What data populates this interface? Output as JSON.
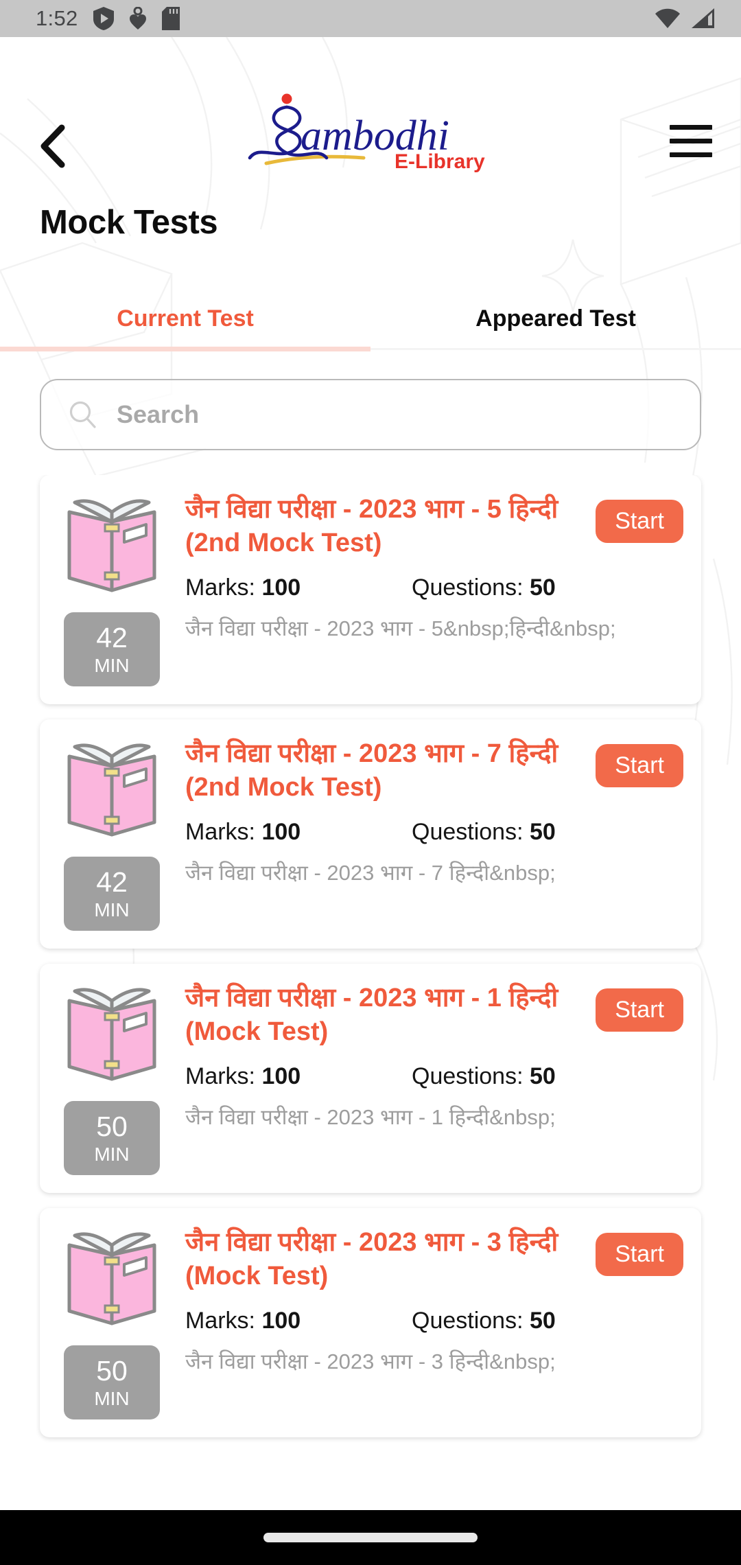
{
  "status_bar": {
    "time": "1:52",
    "icons": [
      "play-shield-icon",
      "heart-pulse-icon",
      "sd-card-icon",
      "wifi-icon",
      "cellular-signal-icon"
    ]
  },
  "header": {
    "back_icon": "chevron-left-icon",
    "menu_icon": "hamburger-menu-icon",
    "logo": {
      "brand": "Sambodhi",
      "subtitle": "E-Library",
      "brand_color": "#1c1c8c",
      "subtitle_color": "#e8332a",
      "swash_color": "#e8b93a",
      "dot_color": "#e8332a"
    }
  },
  "page": {
    "title": "Mock Tests"
  },
  "tabs": {
    "items": [
      {
        "label": "Current Test",
        "active": true
      },
      {
        "label": "Appeared Test",
        "active": false
      }
    ],
    "active_color": "#f05a3c",
    "inactive_color": "#0d0d0d",
    "underline_color": "#fbd9d2"
  },
  "search": {
    "icon": "search-icon",
    "value": "",
    "placeholder": "Search"
  },
  "tests": [
    {
      "icon": "open-book-icon",
      "title": "जैन विद्या परीक्षा - 2023 भाग - 5 हिन्दी (2nd Mock Test)",
      "marks_label": "Marks:",
      "marks_value": "100",
      "questions_label": "Questions:",
      "questions_value": "50",
      "duration_value": "42",
      "duration_unit": "MIN",
      "description": "जैन विद्या परीक्षा - 2023 भाग - 5&nbsp;हिन्दी&nbsp;",
      "action_label": "Start"
    },
    {
      "icon": "open-book-icon",
      "title": "जैन विद्या परीक्षा - 2023 भाग - 7 हिन्दी (2nd Mock Test)",
      "marks_label": "Marks:",
      "marks_value": "100",
      "questions_label": "Questions:",
      "questions_value": "50",
      "duration_value": "42",
      "duration_unit": "MIN",
      "description": "जैन विद्या परीक्षा - 2023 भाग - 7 हिन्दी&nbsp;",
      "action_label": "Start"
    },
    {
      "icon": "open-book-icon",
      "title": "जैन विद्या परीक्षा - 2023 भाग - 1 हिन्दी (Mock Test)",
      "marks_label": "Marks:",
      "marks_value": "100",
      "questions_label": "Questions:",
      "questions_value": "50",
      "duration_value": "50",
      "duration_unit": "MIN",
      "description": "जैन विद्या परीक्षा - 2023 भाग - 1 हिन्दी&nbsp;",
      "action_label": "Start"
    },
    {
      "icon": "open-book-icon",
      "title": "जैन विद्या परीक्षा - 2023 भाग - 3 हिन्दी (Mock Test)",
      "marks_label": "Marks:",
      "marks_value": "100",
      "questions_label": "Questions:",
      "questions_value": "50",
      "duration_value": "50",
      "duration_unit": "MIN",
      "description": "जैन विद्या परीक्षा - 2023 भाग - 3 हिन्दी&nbsp;",
      "action_label": "Start"
    }
  ],
  "nav_bar": {
    "gesture_pill": "home-gesture-pill"
  },
  "colors": {
    "accent": "#f05a3c",
    "start_button": "#f26a4a",
    "badge_gray": "#a0a0a0",
    "status_bar": "#c6c6c6",
    "book_pink": "#fbb6dd"
  }
}
